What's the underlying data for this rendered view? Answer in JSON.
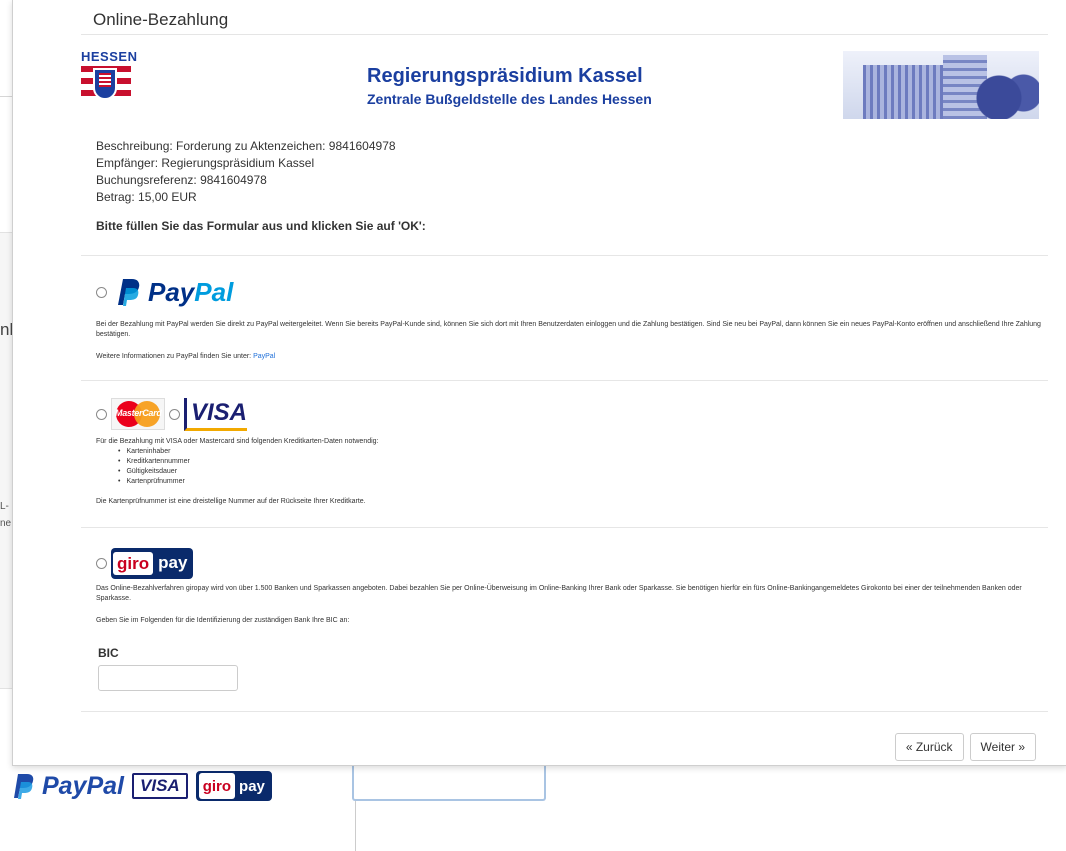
{
  "background": {
    "fragment_nk": "nk",
    "fragment_l": "L-",
    "fragment_ne": "ne",
    "brand_paypal": "PayPal",
    "brand_visa": "VISA",
    "brand_giro_g": "giro",
    "brand_giro_p": "pay"
  },
  "modal": {
    "title": "Online-Bezahlung",
    "header": {
      "hessen": "HESSEN",
      "org_title": "Regierungspräsidium Kassel",
      "org_subtitle": "Zentrale Bußgeldstelle des Landes Hessen"
    },
    "meta": {
      "beschreibung": "Beschreibung: Forderung zu Aktenzeichen: 9841604978",
      "empfaenger": "Empfänger: Regierungspräsidium Kassel",
      "buchungsreferenz": "Buchungsreferenz: 9841604978",
      "betrag": "Betrag: 15,00 EUR"
    },
    "instruction": "Bitte füllen Sie das Formular aus und klicken Sie auf 'OK':",
    "paypal": {
      "logo_p": "P",
      "logo_pay": "Pay",
      "logo_pal": "Pal",
      "description": "Bei der Bezahlung mit PayPal werden Sie direkt zu PayPal weitergeleitet. Wenn Sie bereits PayPal-Kunde sind, können Sie sich dort mit Ihren Benutzerdaten einloggen und die Zahlung bestätigen. Sind Sie neu bei PayPal, dann können Sie ein neues PayPal-Konto eröffnen und anschließend Ihre Zahlung bestätigen.",
      "more_info": "Weitere Informationen zu PayPal finden Sie unter:",
      "more_info_link": "PayPal"
    },
    "cards": {
      "mastercard_label": "MasterCard",
      "visa_label": "VISA",
      "intro": "Für die Bezahlung mit VISA oder Mastercard sind folgenden Kreditkarten-Daten notwendig:",
      "requirements": [
        "Karteninhaber",
        "Kreditkartennummer",
        "Gültigkeitsdauer",
        "Kartenprüfnummer"
      ],
      "note": "Die Kartenprüfnummer ist eine dreistellige Nummer auf der Rückseite Ihrer Kreditkarte."
    },
    "giropay": {
      "logo_giro": "giro",
      "logo_pay": "pay",
      "description": "Das Online-Bezahlverfahren giropay wird von über 1.500 Banken und Sparkassen angeboten. Dabei bezahlen Sie per Online-Überweisung im Online-Banking Ihrer Bank oder Sparkasse. Sie benötigen hierfür ein fürs Online-Bankingangemeldetes Girokonto bei einer der teilnehmenden Banken oder Sparkasse.",
      "bic_instruction": "Geben Sie im Folgenden für die Identifizierung der zuständigen Bank Ihre BIC an:",
      "bic_label": "BIC",
      "bic_value": ""
    },
    "buttons": {
      "back": "« Zurück",
      "next": "Weiter »"
    }
  }
}
